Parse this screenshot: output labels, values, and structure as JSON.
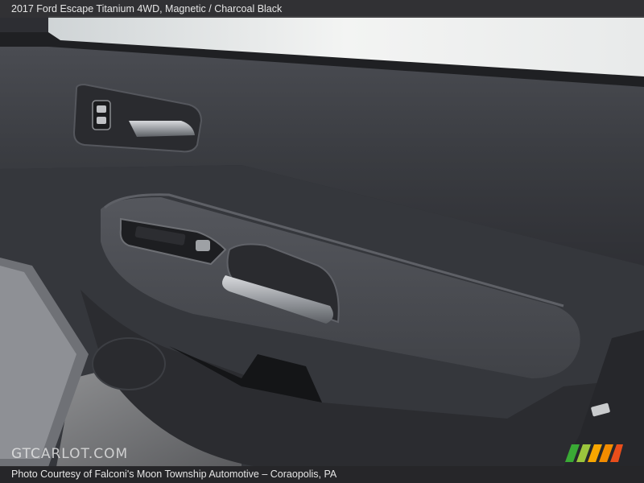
{
  "header": {
    "title": "2017 Ford Escape Titanium 4WD,  Magnetic / Charcoal Black"
  },
  "footer": {
    "credit": "Photo Courtesy of Falconi's Moon Township Automotive – Coraopolis, PA"
  },
  "watermark": {
    "text": "GTCARLOT.COM"
  },
  "logo": {
    "name": "gtcarlot-stripes-logo",
    "colors": [
      "#3aaa35",
      "#9bc53d",
      "#f7a600",
      "#f28c00",
      "#e94e1b"
    ]
  },
  "photo": {
    "subject": "door-panel"
  }
}
